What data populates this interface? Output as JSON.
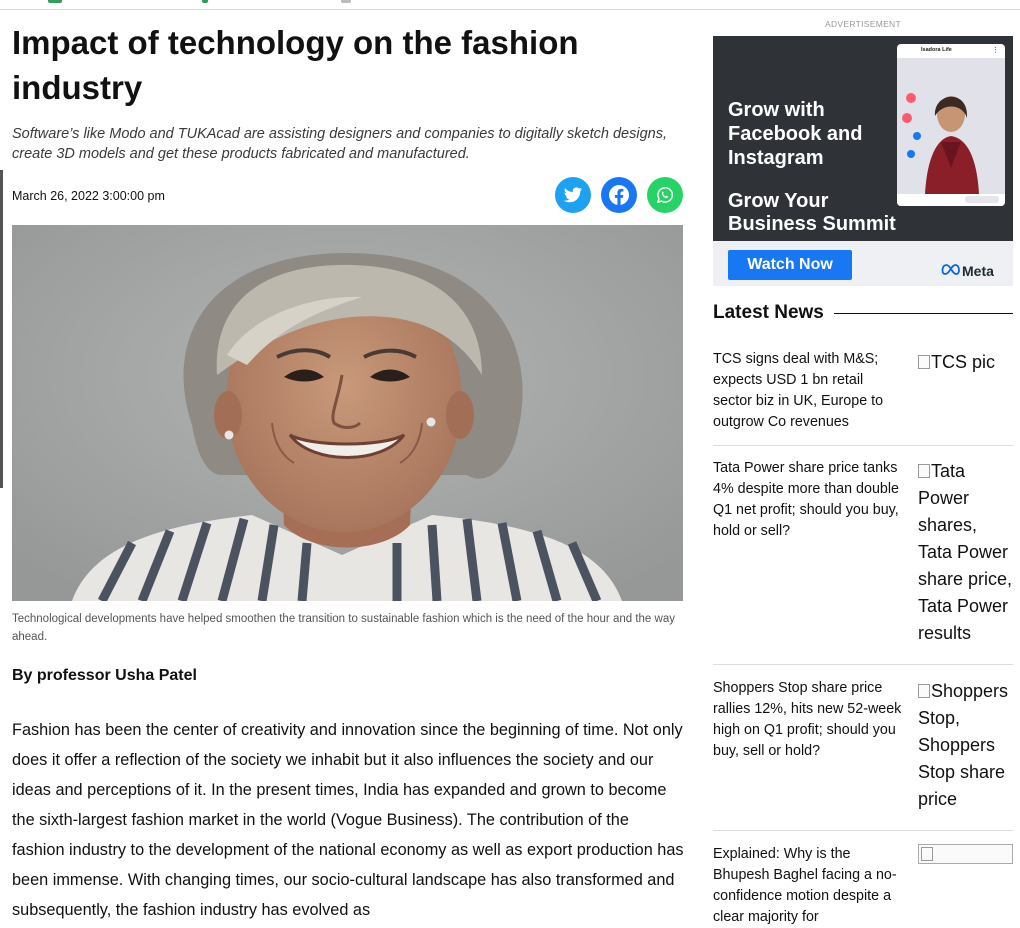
{
  "article": {
    "headline": "Impact of technology on the fashion industry",
    "subtitle": "Software’s like Modo and TUKAcad are assisting designers and companies to digitally sketch designs, create 3D models and get these products fabricated and manufactured.",
    "date": "March 26, 2022 3:00:00 pm",
    "share": {
      "twitter_icon": "twitter-icon",
      "facebook_icon": "facebook-icon",
      "whatsapp_icon": "whatsapp-icon",
      "colors": {
        "twitter": "#1da1f2",
        "facebook": "#1877f2",
        "whatsapp": "#25d366"
      }
    },
    "caption": "Technological developments have helped smoothen the transition to sustainable fashion which is the need of the hour and the way ahead.",
    "byline": "By professor Usha Patel",
    "body": "Fashion has been the center of creativity and innovation since the beginning of time. Not only does it offer a reflection of the society we inhabit but it also influences the society and our ideas and perceptions of it. In the present times, India has expanded and grown to become the sixth-largest fashion market in the world (Vogue Business). The contribution of the fashion industry to the development of the national economy as well as export production has been immense. With changing times, our socio-cultural landscape has also transformed and subsequently, the fashion industry has evolved as"
  },
  "ad": {
    "label": "ADVERTISEMENT",
    "headline": "Grow with Facebook and Instagram",
    "subheadline": "Grow Your Business Summit",
    "cta": "Watch Now",
    "brand": "Meta",
    "phone_profile": "Isadora Life",
    "colors": {
      "panel": "#2f3337",
      "cta": "#1877f2"
    }
  },
  "latest": {
    "title": "Latest News",
    "items": [
      {
        "title": "TCS signs deal with M&S; expects USD 1 bn retail sector biz in UK, Europe to outgrow Co revenues",
        "image_alt": "TCS pic"
      },
      {
        "title": "Tata Power share price tanks 4% despite more than double Q1 net profit; should you buy, hold or sell?",
        "image_alt": "Tata Power shares, Tata Power share price, Tata Power results"
      },
      {
        "title": "Shoppers Stop share price rallies 12%, hits new 52-week high on Q1 profit; should you buy, sell or hold?",
        "image_alt": "Shoppers Stop, Shoppers Stop share price"
      },
      {
        "title": "Explained: Why is the Bhupesh Baghel facing a no-confidence motion despite a clear majority for",
        "image_alt": ""
      }
    ]
  }
}
